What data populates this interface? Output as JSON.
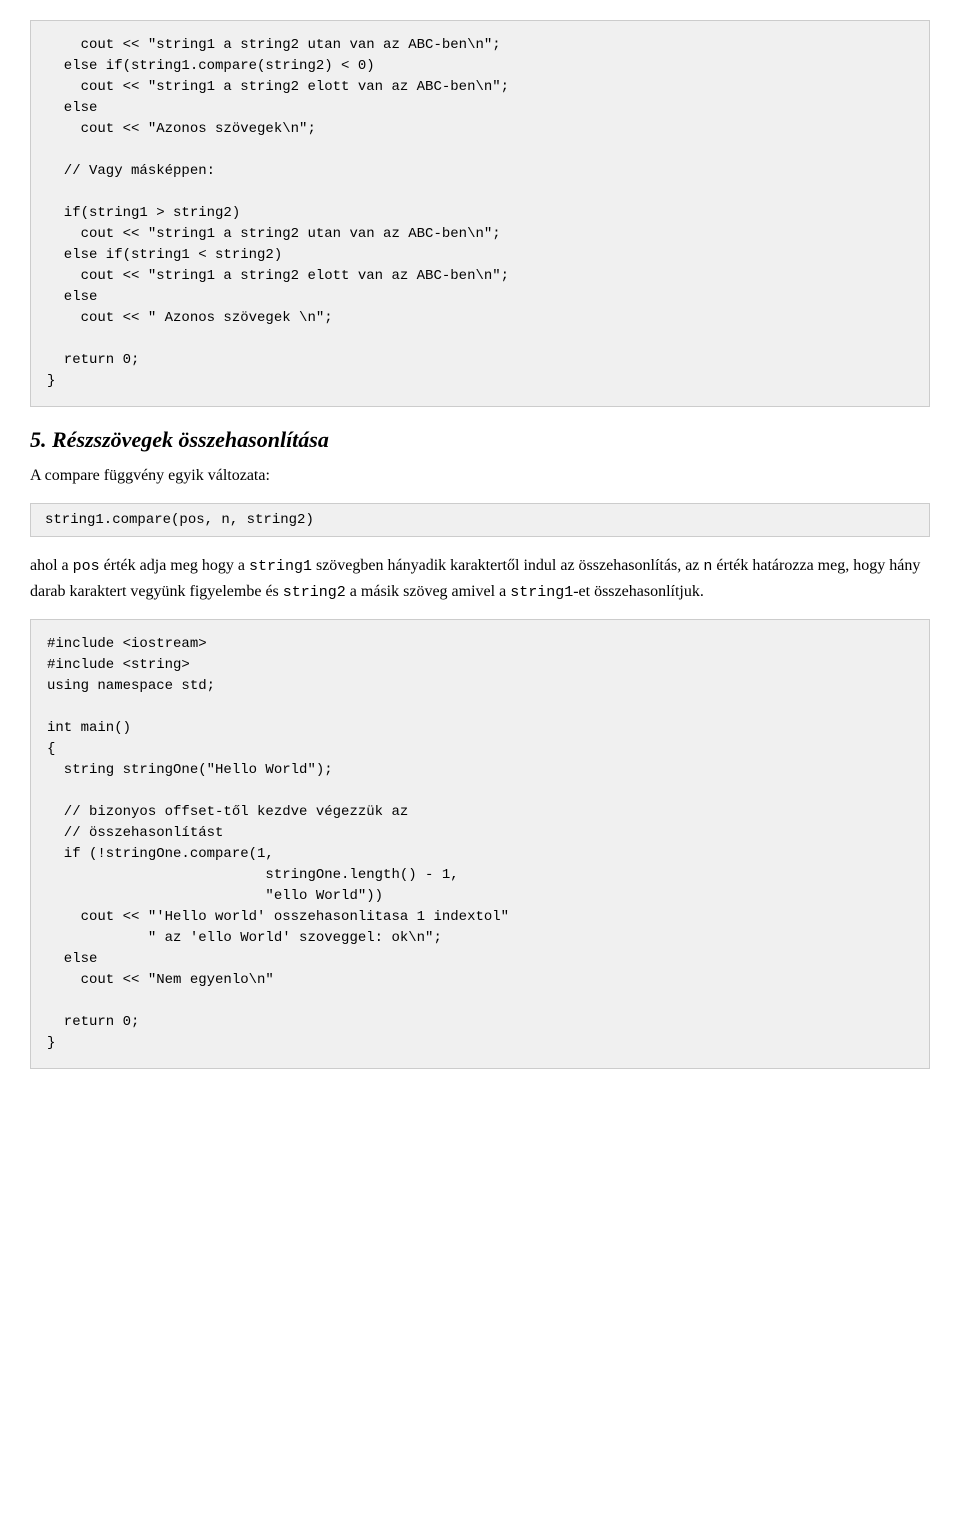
{
  "code_block_1": {
    "content": "    cout << \"string1 a string2 utan van az ABC-ben\\n\";\n  else if(string1.compare(string2) < 0)\n    cout << \"string1 a string2 elott van az ABC-ben\\n\";\n  else\n    cout << \"Azonos szövegek\\n\";\n\n  // Vagy másképpen:\n\n  if(string1 > string2)\n    cout << \"string1 a string2 utan van az ABC-ben\\n\";\n  else if(string1 < string2)\n    cout << \"string1 a string2 elott van az ABC-ben\\n\";\n  else\n    cout << \" Azonos szövegek \\n\";\n\n  return 0;\n}"
  },
  "section_5": {
    "number": "5.",
    "title": "Részszövegek összehasonlítása",
    "subtitle": "A compare függvény egyik változata:"
  },
  "single_line_code": {
    "content": "string1.compare(pos, n, string2)"
  },
  "description": {
    "para1_start": "ahol a ",
    "pos": "pos",
    "para1_mid1": " érték adja meg hogy a ",
    "string1": "string1",
    "para1_mid2": " szövegben hányadik karaktertől indul az összehasonlítás, az ",
    "n": "n",
    "para1_end": " érték határozza meg, hogy hány darab karaktert vegyünk figyelembe és ",
    "string2": "string2",
    "para1_end2": " a másik szöveg amivel a ",
    "string1_2": "string1",
    "para1_end3": "-et összehasonlítjuk."
  },
  "code_block_2": {
    "content": "#include <iostream>\n#include <string>\nusing namespace std;\n\nint main()\n{\n  string stringOne(\"Hello World\");\n\n  // bizonyos offset-től kezdve végezzük az\n  // összehasonlítást\n  if (!stringOne.compare(1,\n                          stringOne.length() - 1,\n                          \"ello World\"))\n    cout << \"'Hello world' osszehasonlitasa 1 indextol\"\n            \" az 'ello World' szoveggel: ok\\n\";\n  else\n    cout << \"Nem egyenlo\\n\"\n\n  return 0;\n}"
  }
}
